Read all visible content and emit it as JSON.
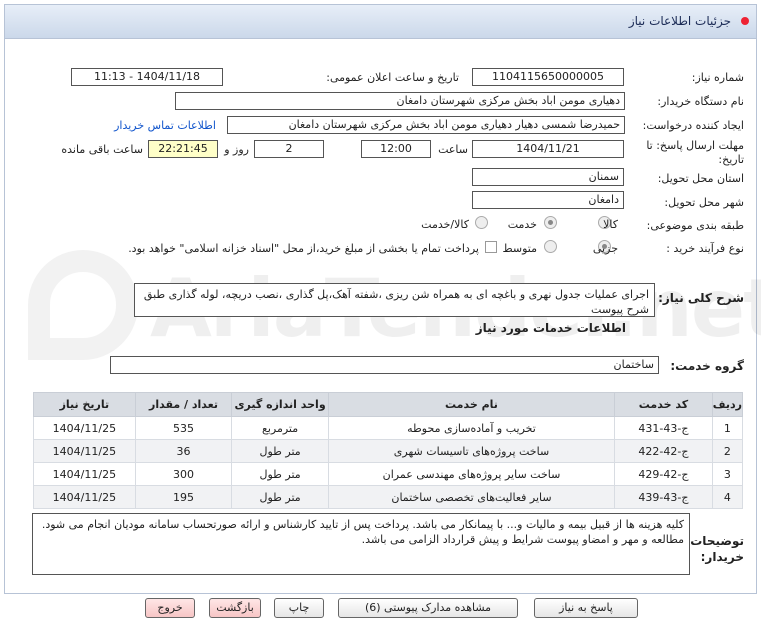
{
  "header": {
    "title": "جزئیات اطلاعات نیاز"
  },
  "watermark": {
    "text": "AriaTender.net"
  },
  "fields": {
    "need_number_label": "شماره نیاز:",
    "need_number": "1104115650000005",
    "announce_label": "تاریخ و ساعت اعلان عمومی:",
    "announce_value": "1404/11/18 - 11:13",
    "buyer_label": "نام دستگاه خریدار:",
    "buyer_value": "دهیاری مومن اباد بخش مرکزی شهرستان دامغان",
    "creator_label": "ایجاد کننده درخواست:",
    "creator_value": "حمیدرضا شمسی دهیار دهیاری مومن اباد بخش مرکزی شهرستان دامغان",
    "contact_link": "اطلاعات تماس خریدار",
    "deadline_label": "مهلت ارسال پاسخ: تا تاریخ:",
    "deadline_date": "1404/11/21",
    "time_label": "ساعت",
    "deadline_time": "12:00",
    "days_value": "2",
    "days_label": "روز و",
    "remaining_value": "22:21:45",
    "remaining_label": "ساعت باقی مانده",
    "province_label": "استان محل تحویل:",
    "province_value": "سمنان",
    "city_label": "شهر محل تحویل:",
    "city_value": "دامغان",
    "category_label": "طبقه بندی موضوعی:",
    "category_options": [
      "کالا",
      "خدمت",
      "کالا/خدمت"
    ],
    "category_selected": "خدمت",
    "process_label": "نوع فرآیند خرید :",
    "process_options": [
      "جزیی",
      "متوسط"
    ],
    "process_selected": "جزیی",
    "treasury_note": "پرداخت تمام یا بخشی از مبلغ خرید،از محل \"اسناد خزانه اسلامی\" خواهد بود."
  },
  "summary": {
    "label": "شرح کلی نیاز:",
    "text": "اجرای عملیات جدول نهری و باغچه ای به همراه شن ریزی ،شفته آهک،پل گذاری ،نصب دریچه، لوله گذاری طبق شرح پیوست"
  },
  "services_section": {
    "title": "اطلاعات خدمات مورد نیاز",
    "group_label": "گروه خدمت:",
    "group_value": "ساختمان"
  },
  "table": {
    "headers": [
      "ردیف",
      "کد خدمت",
      "نام خدمت",
      "واحد اندازه گیری",
      "تعداد / مقدار",
      "تاریخ نیاز"
    ],
    "rows": [
      [
        "1",
        "ج-43-431",
        "تخریب و آماده‌سازی محوطه",
        "مترمربع",
        "535",
        "1404/11/25"
      ],
      [
        "2",
        "ج-42-422",
        "ساخت پروژه‌های تاسیسات شهری",
        "متر طول",
        "36",
        "1404/11/25"
      ],
      [
        "3",
        "ج-42-429",
        "ساخت سایر پروژه‌های مهندسی عمران",
        "متر طول",
        "300",
        "1404/11/25"
      ],
      [
        "4",
        "ج-43-439",
        "سایر فعالیت‌های تخصصی ساختمان",
        "متر طول",
        "195",
        "1404/11/25"
      ]
    ]
  },
  "notes": {
    "label": "توضیحات خریدار:",
    "line1": "کلیه هزینه ها از قبیل بیمه و مالیات و... با پیمانکار می باشد. پرداخت پس از تایید کارشناس و ارائه صورتحساب سامانه مودیان انجام می شود.",
    "line2": "مطالعه و مهر و امضاو پیوست شرایط و پیش قرارداد الزامی می باشد."
  },
  "buttons": {
    "reply": "پاسخ به نیاز",
    "attachments": "مشاهده مدارک پیوستی (6)",
    "print": "چاپ",
    "back": "بازگشت",
    "exit": "خروج"
  }
}
